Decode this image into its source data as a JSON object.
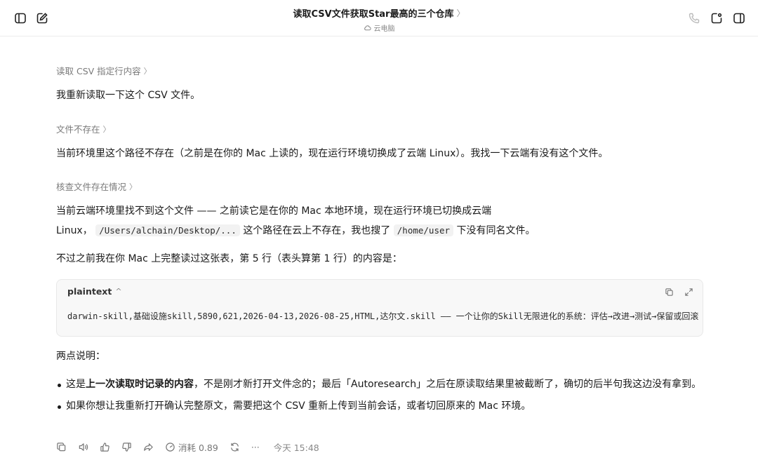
{
  "header": {
    "title": "读取CSV文件获取Star最高的三个仓库",
    "title_chevron": "〉",
    "subtitle": "云电脑"
  },
  "steps": [
    {
      "label": "读取 CSV 指定行内容",
      "chevron": "〉"
    },
    {
      "label": "文件不存在",
      "chevron": "〉"
    },
    {
      "label": "核查文件存在情况",
      "chevron": "〉"
    }
  ],
  "paragraphs": {
    "p1": "我重新读取一下这个 CSV 文件。",
    "p2": "当前环境里这个路径不存在（之前是在你的 Mac 上读的，现在运行环境切换成了云端 Linux）。我找一下云端有没有这个文件。",
    "p3_line1": "当前云端环境里找不到这个文件 —— 之前读它是在你的 Mac 本地环境，现在运行环境已切换成云端",
    "p3_line2_a": "Linux，",
    "p3_code1": "/Users/alchain/Desktop/...",
    "p3_line2_b": "这个路径在云上不存在，我也搜了",
    "p3_code2": "/home/user",
    "p3_line2_c": "下没有同名文件。",
    "p4": "不过之前我在你 Mac 上完整读过这张表，第 5 行（表头算第 1 行）的内容是：",
    "p5": "两点说明："
  },
  "codeblock": {
    "language": "plaintext",
    "caret": "^",
    "code": "darwin-skill,基础设施skill,5890,621,2026-04-13,2026-08-25,HTML,达尔文.skill —— 一个让你的Skill无限进化的系统：评估→改进→测试→保留或回滚"
  },
  "bullets": [
    {
      "prefix": "这是",
      "bold": "上一次读取时记录的内容",
      "suffix": "，不是刚才新打开文件念的；最后「Autoresearch」之后在原读取结果里被截断了，确切的后半句我这边没有拿到。"
    },
    {
      "text": "如果你想让我重新打开确认完整原文，需要把这个 CSV 重新上传到当前会话，或者切回原来的 Mac 环境。"
    }
  ],
  "actions": {
    "cost": "消耗 0.89",
    "more": "···",
    "time": "今天 15:48"
  },
  "icons": [
    "sidebar-toggle-icon",
    "new-chat-icon",
    "phone-icon",
    "share-icon",
    "panel-icon",
    "cloud-icon",
    "copy-icon",
    "expand-icon",
    "speaker-icon",
    "thumbs-up-icon",
    "thumbs-down-icon",
    "forward-icon",
    "refresh-icon"
  ],
  "colors": {
    "text": "#1a1a1a",
    "muted": "#7a7a7a",
    "code_bg": "#f8f8f8"
  }
}
